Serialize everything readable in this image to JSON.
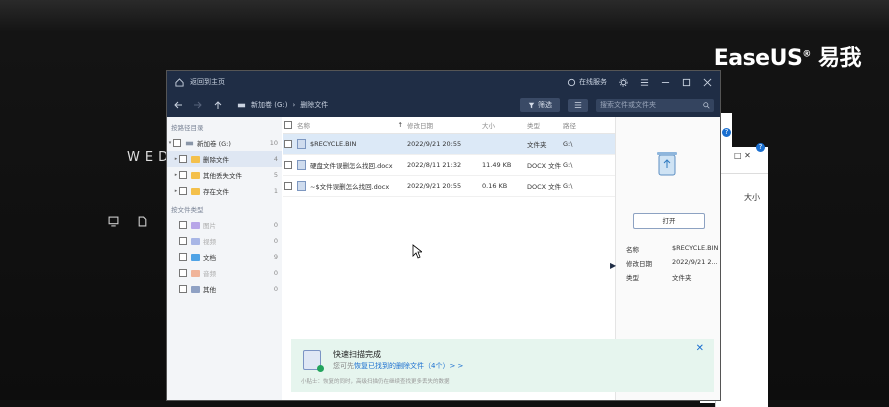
{
  "brand": {
    "name": "EaseUS",
    "reg": "®",
    "cn": "易我"
  },
  "background": {
    "headline": "WED"
  },
  "titlebar": {
    "home_label": "返回到主页",
    "service_label": "在线服务"
  },
  "navbar": {
    "crumb_drive": "新加卷 (G:)",
    "crumb_sep": "›",
    "crumb_folder": "删除文件",
    "filter_label": "筛选",
    "search_placeholder": "搜索文件或文件夹"
  },
  "sidebar": {
    "path_header": "按路径目录",
    "drive": {
      "label": "新加卷 (G:)",
      "count": "10"
    },
    "folders": [
      {
        "label": "删除文件",
        "count": "4"
      },
      {
        "label": "其他丢失文件",
        "count": "5"
      },
      {
        "label": "存在文件",
        "count": "1"
      }
    ],
    "type_header": "按文件类型",
    "types": [
      {
        "label": "图片",
        "count": "0",
        "color": "#b8a6e8"
      },
      {
        "label": "视频",
        "count": "0",
        "color": "#a8b6e6"
      },
      {
        "label": "文档",
        "count": "9",
        "color": "#4fa3e6"
      },
      {
        "label": "音频",
        "count": "0",
        "color": "#f0b49a"
      },
      {
        "label": "其他",
        "count": "0",
        "color": "#8fa1c4"
      }
    ]
  },
  "list": {
    "headers": {
      "name": "名称",
      "date": "修改日期",
      "size": "大小",
      "type": "类型",
      "path": "路径"
    },
    "rows": [
      {
        "name": "$RECYCLE.BIN",
        "date": "2022/9/21 20:55",
        "size": "",
        "type": "文件夹",
        "path": "G:\\"
      },
      {
        "name": "硬盘文件误删怎么找回.docx",
        "date": "2022/8/11 21:32",
        "size": "11.49 KB",
        "type": "DOCX 文件",
        "path": "G:\\"
      },
      {
        "name": "~$文件误删怎么找回.docx",
        "date": "2022/9/21 20:55",
        "size": "0.16 KB",
        "type": "DOCX 文件",
        "path": "G:\\"
      }
    ]
  },
  "banner": {
    "title": "快速扫描完成",
    "line2_prefix": "您可先",
    "line2_link": "恢复已找到的删除文件（4个）> >",
    "tip": "小贴士：恢复的同时，高级扫描仍在继续查找更多丢失的数据"
  },
  "detail": {
    "open_label": "打开",
    "fields": [
      {
        "key": "名称",
        "value": "$RECYCLE.BIN"
      },
      {
        "key": "修改日期",
        "value": "2022/9/21 2..."
      },
      {
        "key": "类型",
        "value": "文件夹"
      }
    ]
  },
  "ghost": {
    "size_label": "大小"
  },
  "colors": {
    "titlebar": "#1f2d45",
    "accent": "#1a6fd0",
    "success": "#22a45d"
  }
}
